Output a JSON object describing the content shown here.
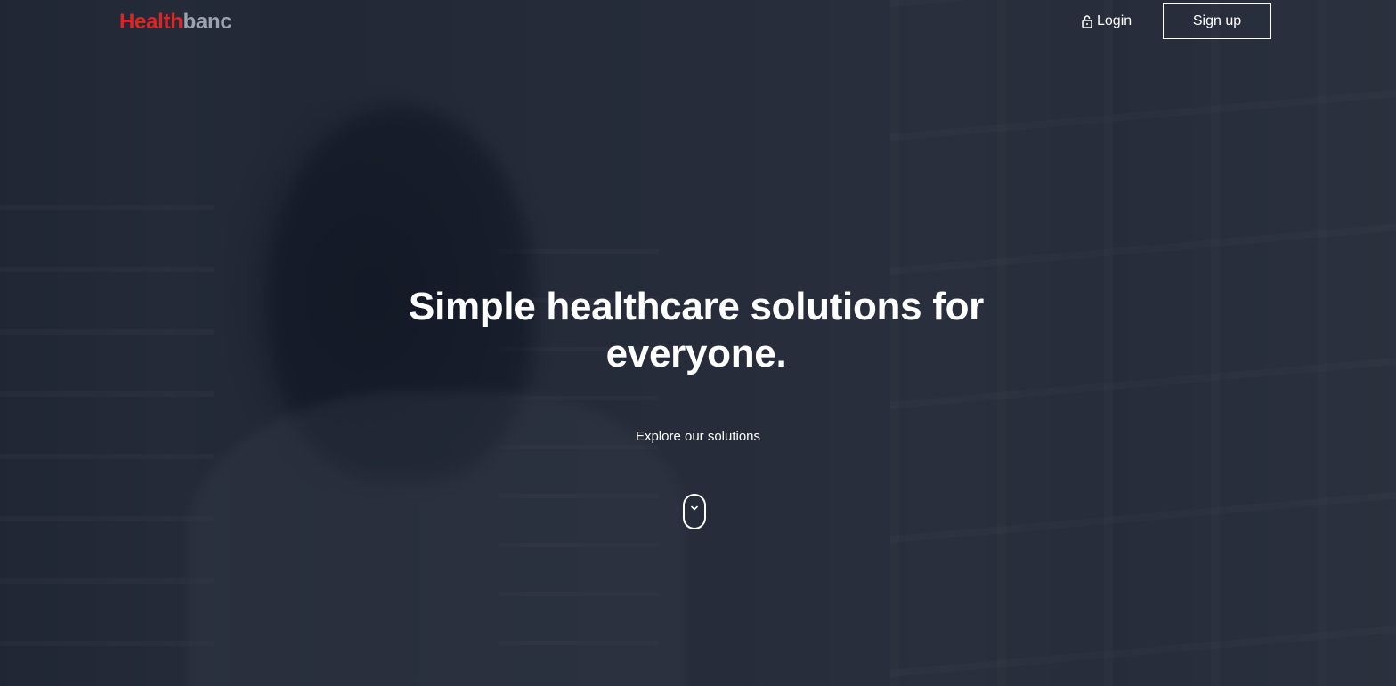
{
  "header": {
    "logo": {
      "part_one": "Health",
      "part_two": "banc"
    },
    "login_label": "Login",
    "signup_label": "Sign up"
  },
  "hero": {
    "headline": "Simple healthcare solutions for everyone.",
    "explore_label": "Explore our solutions",
    "scroll_icon": "chevron-down-icon"
  },
  "colors": {
    "brand_red": "#dc2626",
    "brand_gray": "#9ca3af",
    "overlay": "#111827",
    "text": "#ffffff"
  },
  "icons": {
    "login": "lock-icon",
    "scroll": "chevron-down-icon"
  }
}
